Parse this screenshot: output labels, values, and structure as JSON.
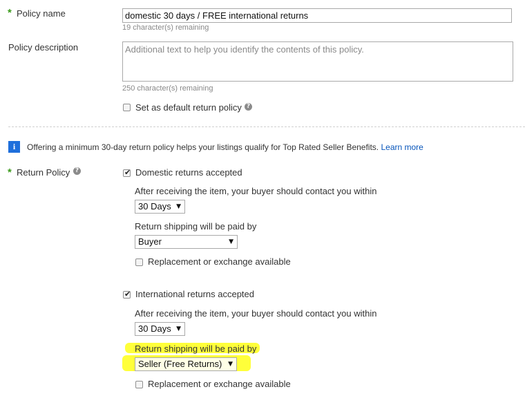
{
  "policy_name": {
    "label": "Policy name",
    "value": "domestic 30 days / FREE international returns",
    "remaining": "19 character(s) remaining"
  },
  "policy_description": {
    "label": "Policy description",
    "placeholder": "Additional text to help you identify the contents of this policy.",
    "remaining": "250 character(s) remaining"
  },
  "default_policy": {
    "label": "Set as default return policy",
    "checked": false
  },
  "info_banner": {
    "text": "Offering a minimum 30-day return policy helps your listings qualify for Top Rated Seller Benefits.",
    "link": "Learn more"
  },
  "return_policy": {
    "label": "Return Policy",
    "domestic": {
      "accepted_label": "Domestic returns accepted",
      "accepted_checked": true,
      "contact_label": "After receiving the item, your buyer should contact you within",
      "contact_value": "30 Days",
      "shipping_label": "Return shipping will be paid by",
      "shipping_value": "Buyer",
      "replacement_label": "Replacement or exchange available",
      "replacement_checked": false
    },
    "international": {
      "accepted_label": "International returns accepted",
      "accepted_checked": true,
      "contact_label": "After receiving the item, your buyer should contact you within",
      "contact_value": "30 Days",
      "shipping_label": "Return shipping will be paid by",
      "shipping_value": "Seller (Free Returns)",
      "replacement_label": "Replacement or exchange available",
      "replacement_checked": false
    }
  },
  "colors": {
    "required_star": "#3a9a1a",
    "link": "#0654ba",
    "info_icon": "#1f6fdb",
    "highlight": "#ffff3a"
  },
  "icons": {
    "required": "required-star-icon",
    "help": "help-question-icon",
    "info": "info-icon",
    "dropdown": "dropdown-arrow-icon",
    "check": "checkmark-icon"
  }
}
